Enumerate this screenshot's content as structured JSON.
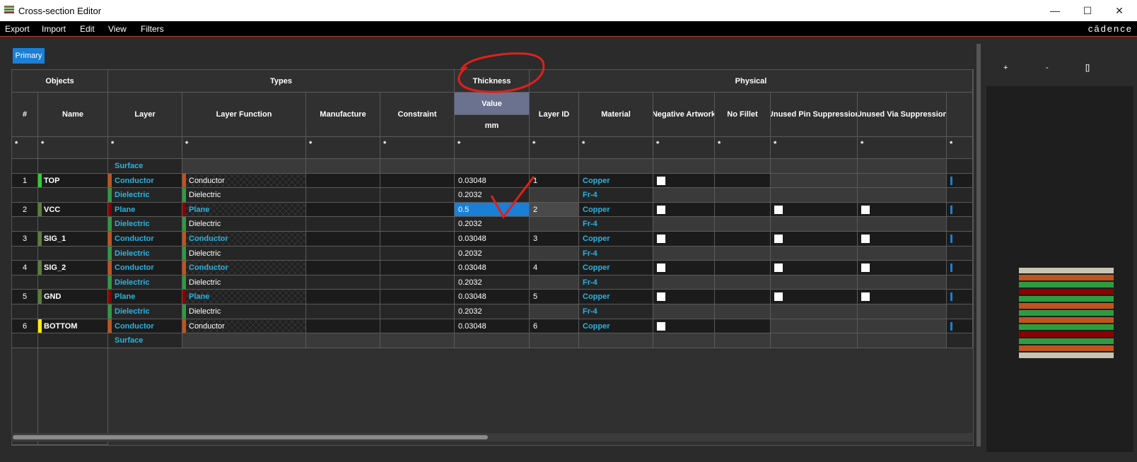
{
  "window": {
    "title": "Cross-section Editor",
    "controls": {
      "minimize": "—",
      "maximize": "☐",
      "close": "✕"
    }
  },
  "menu": {
    "items": [
      "Export",
      "Import",
      "Edit",
      "View",
      "Filters"
    ],
    "brand": "cādence"
  },
  "tabs": {
    "primary": "Primary"
  },
  "groups": {
    "objects": "Objects",
    "types": "Types",
    "thickness": "Thickness",
    "physical": "Physical",
    "collapse_icon": "◀◀",
    "left_arrow": "◀",
    "right_arrow": "▶"
  },
  "columns": {
    "num": "#",
    "name": "Name",
    "layer": "Layer",
    "layer_function": "Layer Function",
    "manufacture": "Manufacture",
    "constraint": "Constraint",
    "value": "Value",
    "unit": "mm",
    "layer_id": "Layer ID",
    "material": "Material",
    "negative_artwork": "Negative Artwork",
    "no_fillet": "No Fillet",
    "unused_pin": "Unused Pin Suppression",
    "unused_via": "Unused Via Suppression"
  },
  "filter_symbol": "*",
  "rows": [
    {
      "num": "",
      "name": "",
      "layer": "Surface",
      "function": "",
      "thickness": "",
      "layer_id": "",
      "material": "",
      "neg": false,
      "pin": false,
      "via": false,
      "kind": "surface"
    },
    {
      "num": "1",
      "name": "TOP",
      "layer": "Conductor",
      "function": "Conductor",
      "thickness": "0.03048",
      "layer_id": "1",
      "material": "Copper",
      "neg": true,
      "pin": false,
      "via": false,
      "kind": "conductor",
      "name_color": "#33cc33",
      "func_cyan": false
    },
    {
      "num": "",
      "name": "",
      "layer": "Dielectric",
      "function": "Dielectric",
      "thickness": "0.2032",
      "layer_id": "",
      "material": "Fr-4",
      "neg": false,
      "pin": false,
      "via": false,
      "kind": "dielectric"
    },
    {
      "num": "2",
      "name": "VCC",
      "layer": "Plane",
      "function": "Plane",
      "thickness": "0.5",
      "layer_id": "2",
      "material": "Copper",
      "neg": true,
      "pin": true,
      "via": true,
      "kind": "plane",
      "name_color": "#5a7d3a",
      "func_cyan": true,
      "selected": true
    },
    {
      "num": "",
      "name": "",
      "layer": "Dielectric",
      "function": "Dielectric",
      "thickness": "0.2032",
      "layer_id": "",
      "material": "Fr-4",
      "neg": false,
      "pin": false,
      "via": false,
      "kind": "dielectric"
    },
    {
      "num": "3",
      "name": "SIG_1",
      "layer": "Conductor",
      "function": "Conductor",
      "thickness": "0.03048",
      "layer_id": "3",
      "material": "Copper",
      "neg": true,
      "pin": true,
      "via": true,
      "kind": "conductor",
      "name_color": "#5a7d3a",
      "func_cyan": true
    },
    {
      "num": "",
      "name": "",
      "layer": "Dielectric",
      "function": "Dielectric",
      "thickness": "0.2032",
      "layer_id": "",
      "material": "Fr-4",
      "neg": false,
      "pin": false,
      "via": false,
      "kind": "dielectric"
    },
    {
      "num": "4",
      "name": "SIG_2",
      "layer": "Conductor",
      "function": "Conductor",
      "thickness": "0.03048",
      "layer_id": "4",
      "material": "Copper",
      "neg": true,
      "pin": true,
      "via": true,
      "kind": "conductor",
      "name_color": "#5a7d3a",
      "func_cyan": true
    },
    {
      "num": "",
      "name": "",
      "layer": "Dielectric",
      "function": "Dielectric",
      "thickness": "0.2032",
      "layer_id": "",
      "material": "Fr-4",
      "neg": false,
      "pin": false,
      "via": false,
      "kind": "dielectric"
    },
    {
      "num": "5",
      "name": "GND",
      "layer": "Plane",
      "function": "Plane",
      "thickness": "0.03048",
      "layer_id": "5",
      "material": "Copper",
      "neg": true,
      "pin": true,
      "via": true,
      "kind": "plane",
      "name_color": "#5a7d3a",
      "func_cyan": true
    },
    {
      "num": "",
      "name": "",
      "layer": "Dielectric",
      "function": "Dielectric",
      "thickness": "0.2032",
      "layer_id": "",
      "material": "Fr-4",
      "neg": false,
      "pin": false,
      "via": false,
      "kind": "dielectric"
    },
    {
      "num": "6",
      "name": "BOTTOM",
      "layer": "Conductor",
      "function": "Conductor",
      "thickness": "0.03048",
      "layer_id": "6",
      "material": "Copper",
      "neg": true,
      "pin": false,
      "via": false,
      "kind": "conductor",
      "name_color": "#ffee00",
      "func_cyan": false
    },
    {
      "num": "",
      "name": "",
      "layer": "Surface",
      "function": "",
      "thickness": "",
      "layer_id": "",
      "material": "",
      "neg": false,
      "pin": false,
      "via": false,
      "kind": "surface"
    }
  ],
  "preview_toolbar": [
    "+",
    "-",
    "[]"
  ],
  "colors": {
    "conductor": "#c0541c",
    "plane": "#8b0000",
    "dielectric": "#2e9b43",
    "surface": "#c8c4b4",
    "cyan_text": "#2ab3e0",
    "selection": "#1a7fd6",
    "annotation": "#e0201a"
  }
}
